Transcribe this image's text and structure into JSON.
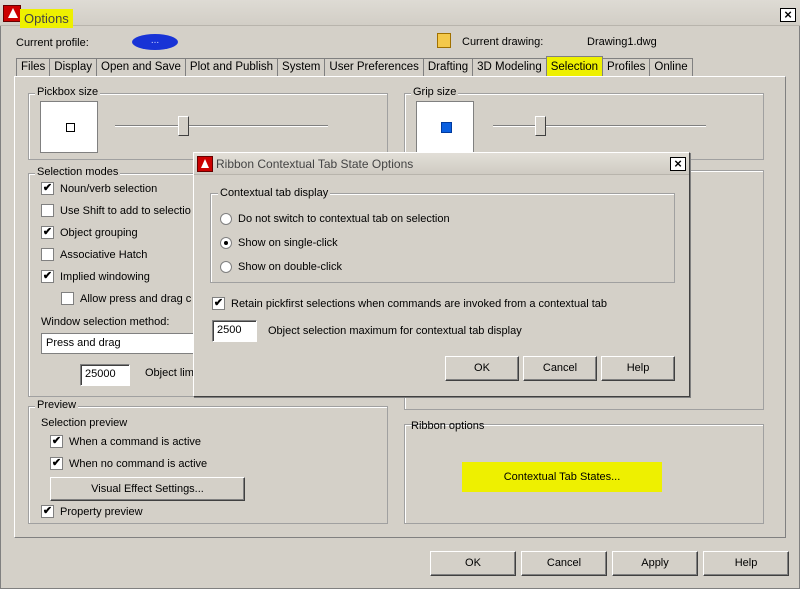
{
  "window": {
    "title": "Options",
    "close": "×"
  },
  "profile": {
    "label": "Current profile:",
    "value": "..."
  },
  "drawing": {
    "label": "Current drawing:",
    "value": "Drawing1.dwg"
  },
  "tabs": [
    "Files",
    "Display",
    "Open and Save",
    "Plot and Publish",
    "System",
    "User Preferences",
    "Drafting",
    "3D Modeling",
    "Selection",
    "Profiles",
    "Online"
  ],
  "active_tab": "Selection",
  "pickbox": {
    "label": "Pickbox size",
    "level": 0.32
  },
  "grip": {
    "label": "Grip size",
    "level": 0.22
  },
  "selection_modes": {
    "label": "Selection modes",
    "items": [
      {
        "label": "Noun/verb selection",
        "checked": true
      },
      {
        "label": "Use Shift to add to selectio",
        "checked": false
      },
      {
        "label": "Object grouping",
        "checked": true
      },
      {
        "label": "Associative Hatch",
        "checked": false
      },
      {
        "label": "Implied windowing",
        "checked": true
      },
      {
        "label": "Allow press and drag c",
        "checked": false
      }
    ],
    "window_method_label": "Window selection method:",
    "window_method_value": "Press and drag",
    "object_limit_value": "25000",
    "object_limit_label": "Object lim"
  },
  "preview": {
    "label": "Preview",
    "selection_preview_label": "Selection preview",
    "items": [
      {
        "label": "When a command is active",
        "checked": true
      },
      {
        "label": "When no command is active",
        "checked": true
      }
    ],
    "visual_effect_button": "Visual Effect Settings...",
    "property_preview": {
      "label": "Property preview",
      "checked": true
    }
  },
  "ribbon": {
    "label": "Ribbon options",
    "button": "Contextual Tab States..."
  },
  "footer": {
    "ok": "OK",
    "cancel": "Cancel",
    "apply": "Apply",
    "help": "Help"
  },
  "dialog": {
    "title": "Ribbon Contextual Tab State Options",
    "close": "×",
    "group_label": "Contextual tab display",
    "radios": [
      {
        "label": "Do not switch to contextual tab on selection",
        "selected": false
      },
      {
        "label": "Show on single-click",
        "selected": true
      },
      {
        "label": "Show on double-click",
        "selected": false
      }
    ],
    "retain": {
      "label": "Retain pickfirst selections when commands are invoked from a contextual tab",
      "checked": true
    },
    "max_value": "2500",
    "max_label": "Object selection maximum for contextual tab display",
    "ok": "OK",
    "cancel": "Cancel",
    "help": "Help"
  },
  "colors": {
    "highlight": "#eef000",
    "profile_blob": "#1833d6",
    "grip_square": "#0a5fe0"
  }
}
